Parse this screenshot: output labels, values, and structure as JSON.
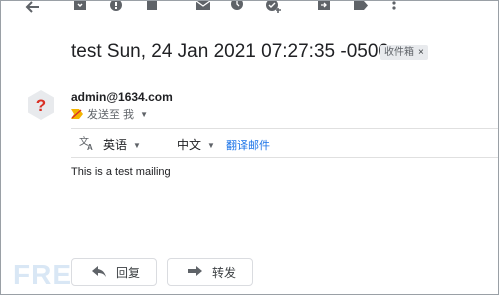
{
  "toolbar": {
    "icons": [
      "back-arrow-icon",
      "archive-icon",
      "report-spam-icon",
      "delete-icon",
      "mark-unread-icon",
      "snooze-icon",
      "add-to-tasks-icon",
      "move-to-icon",
      "labels-icon",
      "more-vert-icon"
    ]
  },
  "email": {
    "subject": "test Sun, 24 Jan 2021 07:27:35 -0500",
    "label_chip": "收件箱",
    "label_remove": "×",
    "sender": "admin@1634.com",
    "recipient_text": "发送至 我",
    "body": "This is a test mailing"
  },
  "translate": {
    "source_lang": "英语",
    "target_lang": "中文",
    "action": "翻译邮件"
  },
  "actions": {
    "reply": "回复",
    "forward": "转发"
  },
  "watermark": "FREEBUF",
  "colors": {
    "link": "#1a73e8",
    "chip_bg": "#e8eaed",
    "avatar_bg": "#e8eaed",
    "avatar_fg": "#d93025",
    "icon": "#5f6368"
  }
}
